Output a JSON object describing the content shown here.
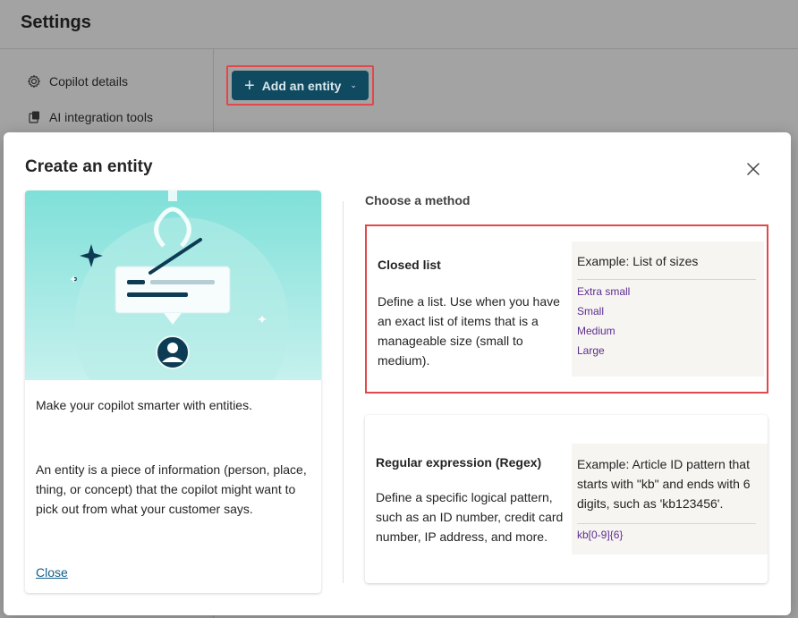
{
  "background": {
    "page_title": "Settings",
    "nav": [
      {
        "label": "Copilot details",
        "icon": "gear-icon"
      },
      {
        "label": "AI integration tools",
        "icon": "integration-icon"
      }
    ],
    "add_button": {
      "label": "Add an entity",
      "icon": "plus-icon"
    }
  },
  "modal": {
    "title": "Create an entity",
    "close_icon": "close-icon",
    "left_card": {
      "intro": "Make your copilot smarter with entities.",
      "description": "An entity is a piece of information (person, place, thing, or concept) that the copilot might want to pick out from what your customer says.",
      "close_link": "Close"
    },
    "choose_label": "Choose a method",
    "methods": [
      {
        "title": "Closed list",
        "description": "Define a list. Use when you have an exact list of items that is a manageable size (small to medium).",
        "example_heading": "Example: List of sizes",
        "example_items": [
          "Extra small",
          "Small",
          "Medium",
          "Large"
        ]
      },
      {
        "title": "Regular expression (Regex)",
        "description": "Define a specific logical pattern, such as an ID number, credit card number, IP address, and more.",
        "example_heading": "Example: Article ID pattern that starts with \"kb\" and ends with 6 digits, such as 'kb123456'.",
        "example_items": [
          "kb[0-9]{6}"
        ]
      }
    ]
  },
  "colors": {
    "accent": "#0f4a61",
    "highlight": "#e0484b",
    "link": "#115e8a",
    "example_text": "#5c2e91"
  }
}
